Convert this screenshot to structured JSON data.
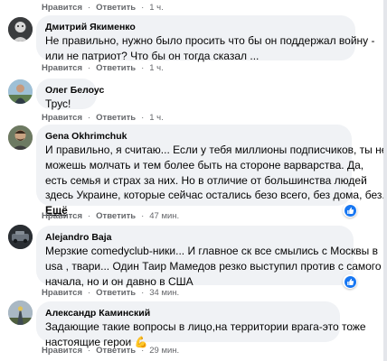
{
  "meta": {
    "accent": "#1877f2",
    "bubble_bg": "#f0f2f5",
    "meta_text_color": "#65676b"
  },
  "top_actions": {
    "like": "Нравится",
    "reply": "Ответить",
    "time": "1 ч."
  },
  "comments": [
    {
      "author": "Дмитрий Якименко",
      "lines": [
        "Не правильно, нужно было просить что бы он поддержал войну -",
        "или не патриот? Что бы он тогда сказал ..."
      ],
      "like": "Нравится",
      "reply": "Ответить",
      "time": "1 ч."
    },
    {
      "author": "Олег Белоус",
      "lines": [
        "Трус!"
      ],
      "like": "Нравится",
      "reply": "Ответить",
      "time": "1 ч."
    },
    {
      "author": "Gena Okhrimchuk",
      "lines": [
        "И правильно, я считаю... Если у тебя миллионы подписчиков, ты не",
        "можешь молчать и тем более быть на стороне варварства. Да,",
        "есть семья и страх за них. Но в отличие от большинства людей",
        "здесь Украине, которые сейчас остались безо всего, без дома, без..."
      ],
      "more": "Ещё",
      "like": "Нравится",
      "reply": "Ответить",
      "time": "47 мин.",
      "reaction_icon": "like-reaction-icon"
    },
    {
      "author": "Alejandro Baja",
      "lines": [
        "Мерзкие comedyclub-ники... И главное ск все смылись с Москвы в",
        "usa , твари... Один Таир Мамедов резко выступил против с самого",
        "начала, но и он давно в США"
      ],
      "like": "Нравится",
      "reply": "Ответить",
      "time": "34 мин.",
      "reaction_icon": "like-reaction-icon"
    },
    {
      "author": "Александр Каминский",
      "lines": [
        "Задающие такие вопросы в лицо,на территории врага-это тоже",
        "настоящие герои"
      ],
      "emoji": "💪",
      "like": "Нравится",
      "reply": "Ответить",
      "time": "29 мин."
    }
  ]
}
